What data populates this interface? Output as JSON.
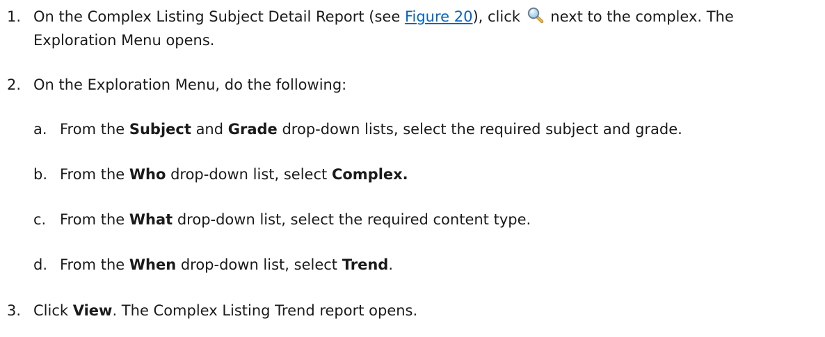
{
  "steps": {
    "s1": {
      "number": "1.",
      "pre": "On the Complex Listing Subject Detail Report (see ",
      "link": "Figure 20",
      "mid": "), click ",
      "icon": "magnifier-icon",
      "post": " next to the complex. The",
      "cont": "Exploration Menu opens."
    },
    "s2": {
      "number": "2.",
      "text": "On the Exploration Menu, do the following:",
      "subs": {
        "a": {
          "letter": "a.",
          "t1": "From the ",
          "b1": "Subject",
          "t2": " and ",
          "b2": "Grade",
          "t3": " drop-down lists, select the required subject and grade."
        },
        "b": {
          "letter": "b.",
          "t1": "From the ",
          "b1": "Who",
          "t2": " drop-down list, select ",
          "b2": "Complex."
        },
        "c": {
          "letter": "c.",
          "t1": "From the ",
          "b1": "What",
          "t2": " drop-down list, select the required content type."
        },
        "d": {
          "letter": "d.",
          "t1": "From the ",
          "b1": "When",
          "t2": " drop-down list, select ",
          "b2": "Trend",
          "t3": "."
        }
      }
    },
    "s3": {
      "number": "3.",
      "t1": "Click ",
      "b1": "View",
      "t2": ". The Complex Listing Trend report opens."
    }
  }
}
